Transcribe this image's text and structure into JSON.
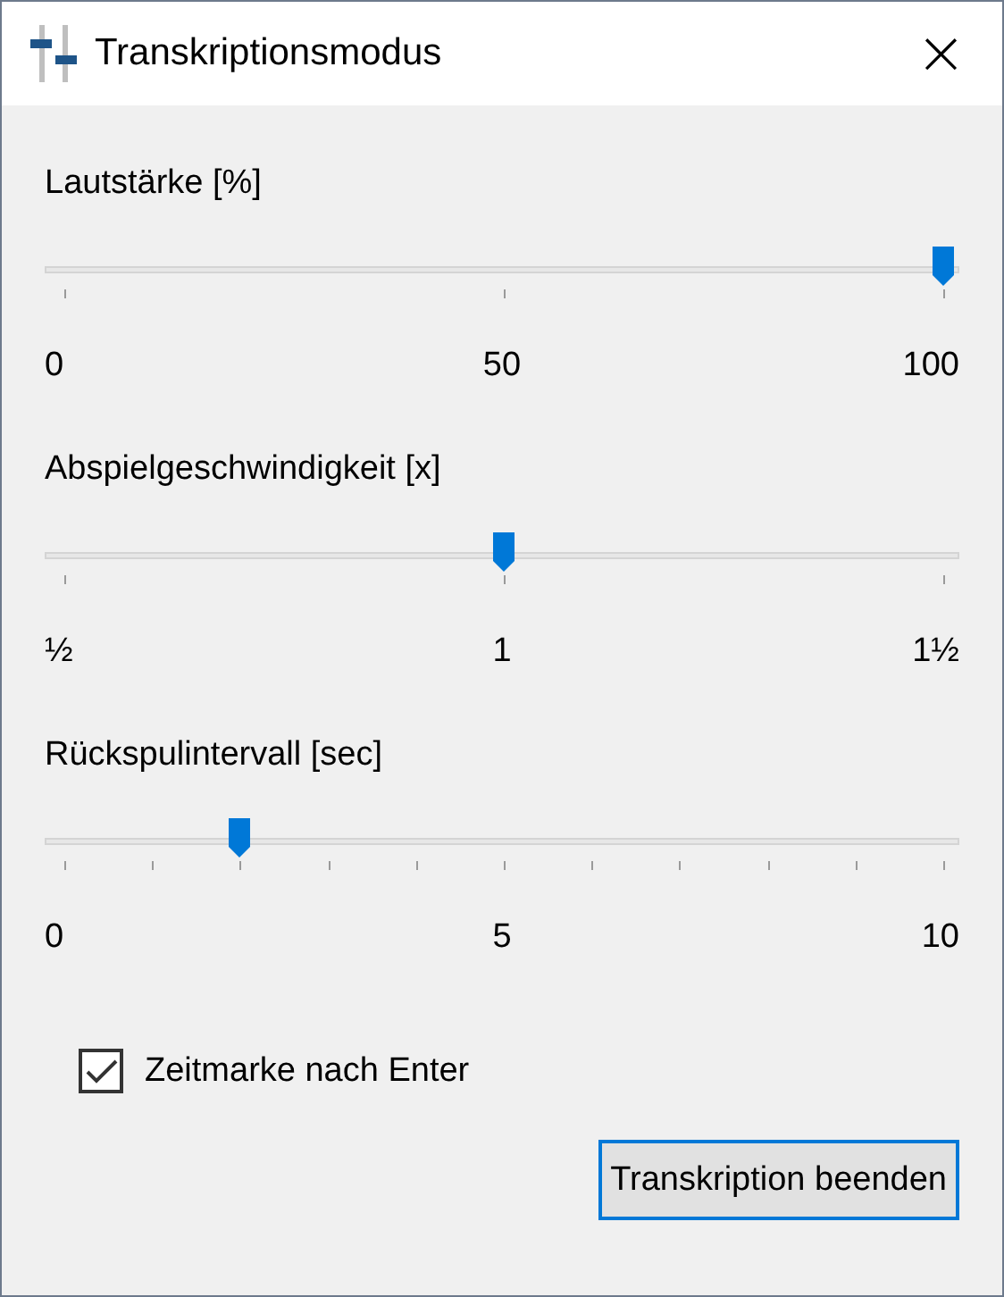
{
  "window": {
    "title": "Transkriptionsmodus",
    "close": "×"
  },
  "sliders": [
    {
      "label": "Lautstärke [%]",
      "level": 1.0,
      "kind": "coarse",
      "scale": [
        "0",
        "50",
        "100"
      ]
    },
    {
      "label": "Abspielgeschwindigkeit [x]",
      "level": 0.5,
      "kind": "coarse",
      "scale": [
        "½",
        "1",
        "1½"
      ]
    },
    {
      "label": "Rückspulintervall [sec]",
      "level": 0.2,
      "kind": "fine",
      "scale": [
        "0",
        "5",
        "10"
      ]
    }
  ],
  "checkbox": {
    "label": "Zeitmarke nach Enter",
    "checked": true
  },
  "button": {
    "label": "Transkription beenden"
  }
}
